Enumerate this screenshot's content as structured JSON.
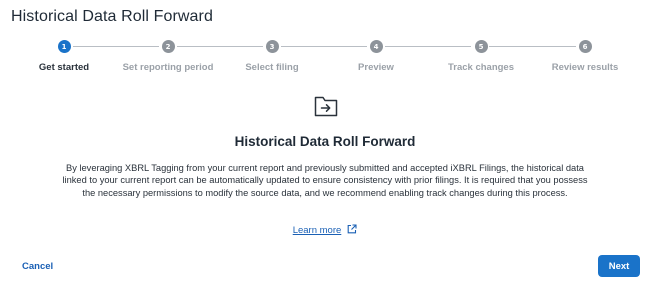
{
  "window": {
    "title": "Historical Data Roll Forward"
  },
  "stepper": {
    "steps": [
      {
        "number": "1",
        "label": "Get started",
        "state": "active"
      },
      {
        "number": "2",
        "label": "Set reporting period",
        "state": "upcoming"
      },
      {
        "number": "3",
        "label": "Select filing",
        "state": "upcoming"
      },
      {
        "number": "4",
        "label": "Preview",
        "state": "upcoming"
      },
      {
        "number": "5",
        "label": "Track changes",
        "state": "upcoming"
      },
      {
        "number": "6",
        "label": "Review results",
        "state": "upcoming"
      }
    ]
  },
  "content": {
    "icon": "folder-arrow-icon",
    "heading": "Historical Data Roll Forward",
    "description": "By leveraging XBRL Tagging from your current report and previously submitted and accepted iXBRL Filings, the historical data linked to your current report can be automatically updated to ensure consistency with prior filings. It is required that you possess the necessary permissions to modify the source data, and we recommend enabling track changes during this process.",
    "link_label": "Learn more",
    "link_icon": "external-link-icon"
  },
  "footer": {
    "cancel_label": "Cancel",
    "next_label": "Next"
  },
  "colors": {
    "accent": "#1a73c9",
    "link": "#1a60b5",
    "inactive": "#8d939a",
    "text": "#1f2a36"
  }
}
